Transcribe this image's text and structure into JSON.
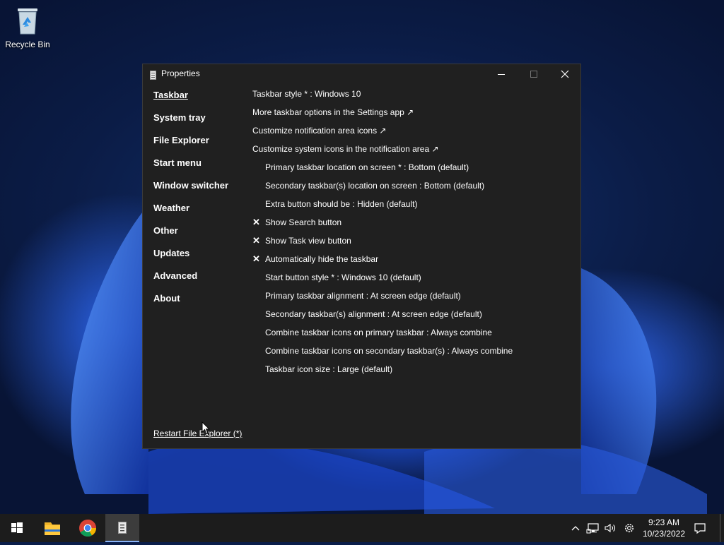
{
  "desktop": {
    "icons": [
      {
        "label": "Recycle Bin",
        "icon": "recycle-bin-icon"
      }
    ]
  },
  "window": {
    "title": "Properties",
    "icon": "document-icon",
    "controls": [
      "minimize-icon",
      "maximize-icon",
      "close-icon"
    ]
  },
  "nav": {
    "items": [
      {
        "label": "Taskbar",
        "active": true
      },
      {
        "label": "System tray"
      },
      {
        "label": "File Explorer"
      },
      {
        "label": "Start menu"
      },
      {
        "label": "Window switcher"
      },
      {
        "label": "Weather"
      },
      {
        "label": "Other"
      },
      {
        "label": "Updates"
      },
      {
        "label": "Advanced"
      },
      {
        "label": "About"
      }
    ]
  },
  "settings": {
    "rows": [
      {
        "text": "Taskbar style * : Windows 10"
      },
      {
        "text": "More taskbar options in the Settings app ↗"
      },
      {
        "text": "Customize notification area icons ↗"
      },
      {
        "text": "Customize system icons in the notification area ↗"
      },
      {
        "text": "Primary taskbar location on screen * : Bottom (default)"
      },
      {
        "text": "Secondary taskbar(s) location on screen : Bottom (default)"
      },
      {
        "text": "Extra button should be : Hidden (default)"
      },
      {
        "text": "Show Search button",
        "check": "✕"
      },
      {
        "text": "Show Task view button",
        "check": "✕"
      },
      {
        "text": "Automatically hide the taskbar",
        "check": "✕"
      },
      {
        "text": "Start button style * : Windows 10 (default)"
      },
      {
        "text": "Primary taskbar alignment : At screen edge (default)"
      },
      {
        "text": "Secondary taskbar(s) alignment : At screen edge (default)"
      },
      {
        "text": "Combine taskbar icons on primary taskbar : Always combine"
      },
      {
        "text": "Combine taskbar icons on secondary taskbar(s) : Always combine"
      },
      {
        "text": "Taskbar icon size : Large (default)"
      }
    ]
  },
  "footer": {
    "restart_label": "Restart File Explorer (*)"
  },
  "taskbar": {
    "pinned": [
      "windows-start-icon",
      "file-explorer-icon",
      "chrome-icon",
      "properties-app-icon"
    ],
    "tray_icons": [
      "chevron-up-icon",
      "network-icon",
      "volume-icon",
      "settings-gear-icon"
    ],
    "time": "9:23 AM",
    "date": "10/23/2022",
    "notification_icon": "notification-icon"
  },
  "colors": {
    "window_bg": "#202020",
    "taskbar_bg": "#1c1c1c",
    "accent": "#8ab4f8"
  }
}
